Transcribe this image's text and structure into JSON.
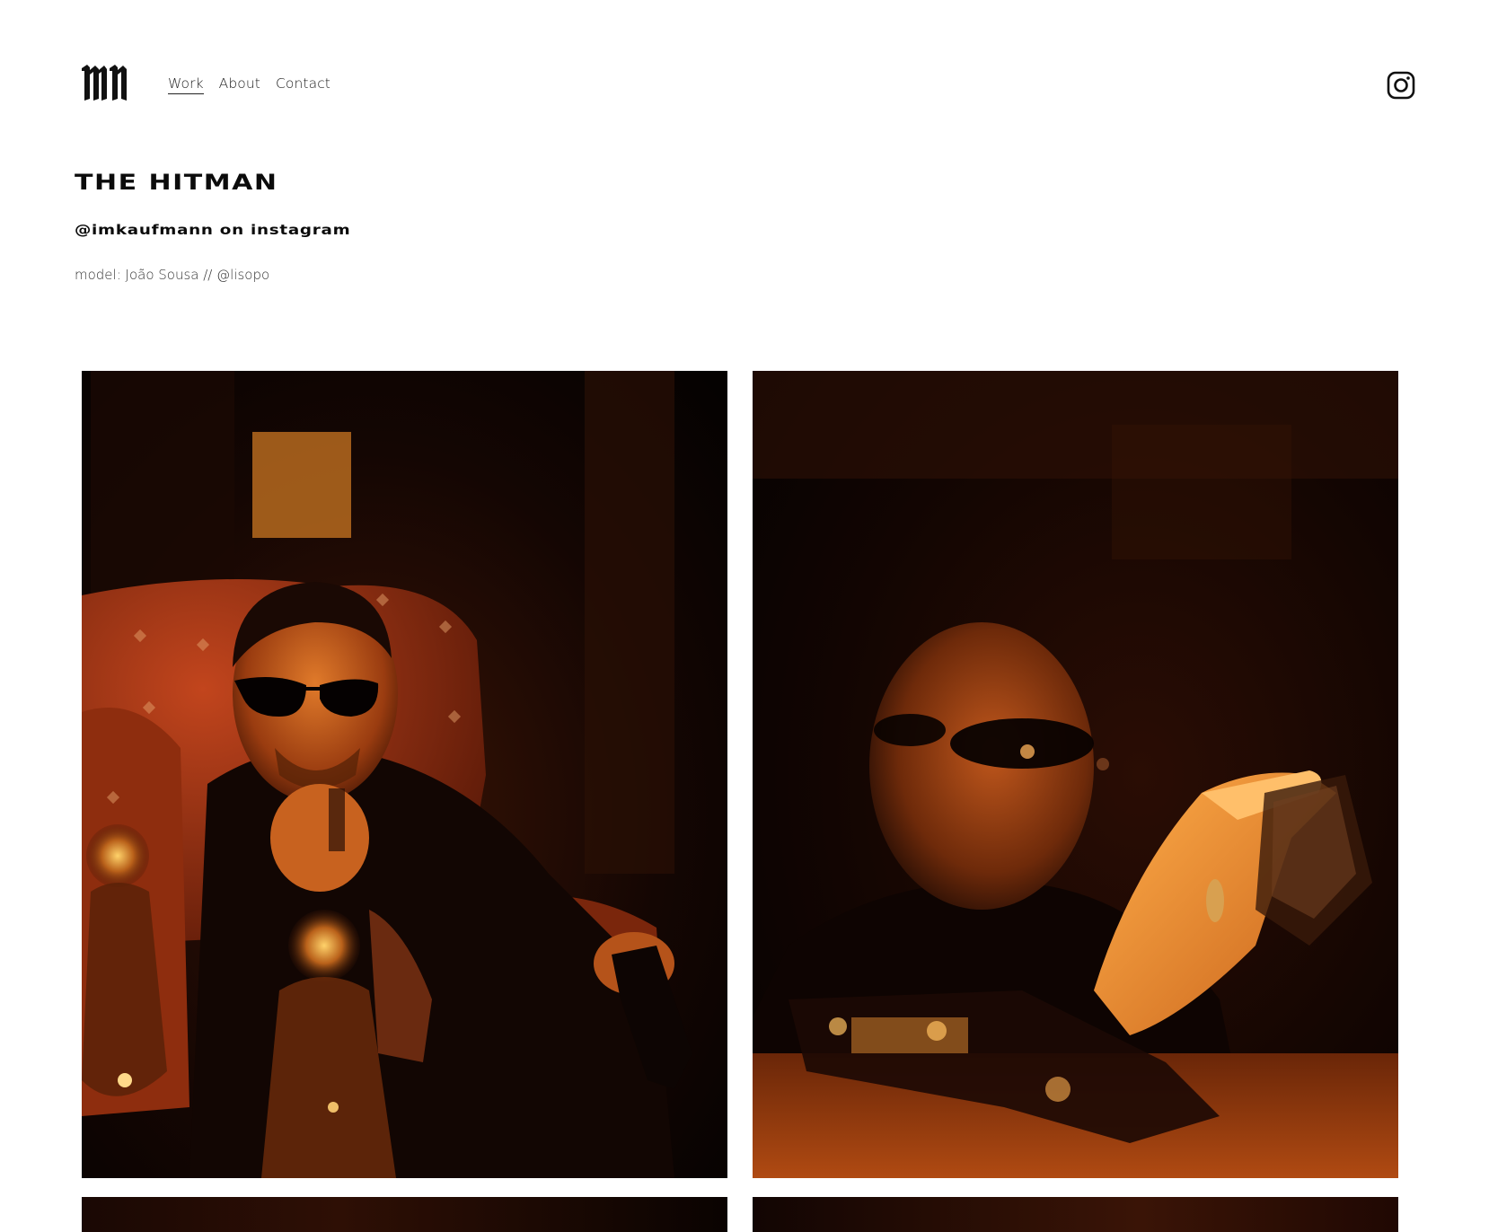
{
  "header": {
    "logo_icon": "mn-blackletter-monogram-icon",
    "nav": [
      {
        "label": "Work",
        "active": true
      },
      {
        "label": "About",
        "active": false
      },
      {
        "label": "Contact",
        "active": false
      }
    ],
    "social_icon": "instagram-icon"
  },
  "project": {
    "title": "THE HITMAN",
    "subtitle": "@imkaufmann on instagram",
    "credit": "model: João Sousa // @lisopo"
  },
  "gallery": {
    "photos": [
      {
        "scene": "man in sunglasses seated in red armchair holding glass, warm amber light, crystal decanters in foreground"
      },
      {
        "scene": "blurred man in sunglasses raising whisky glass, pistol on table in foreground, warm amber light"
      },
      {
        "scene": "dark warm-toned photo (cropped)"
      },
      {
        "scene": "dark warm-toned photo (cropped)"
      }
    ]
  },
  "colors": {
    "background": "#ffffff",
    "text": "#111111",
    "photo_tone": "#c8560a"
  }
}
